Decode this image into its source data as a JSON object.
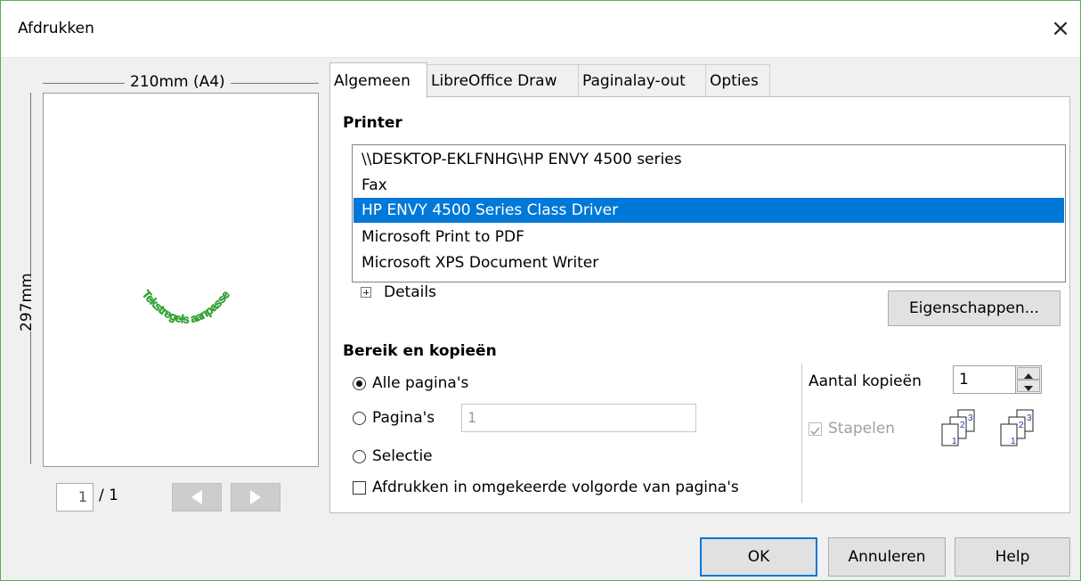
{
  "window": {
    "title": "Afdrukken",
    "close_glyph": "×"
  },
  "preview": {
    "width_label": "210mm (A4)",
    "height_label": "297mm",
    "current_page": "1",
    "total_pages": "/ 1",
    "art_text": "Tekstregels aanpassen",
    "art_color": "#2db52d"
  },
  "tabs": [
    {
      "label": "Algemeen",
      "active": true
    },
    {
      "label": "LibreOffice Draw",
      "active": false
    },
    {
      "label": "Paginalay-out",
      "active": false
    },
    {
      "label": "Opties",
      "active": false
    }
  ],
  "printer": {
    "heading": "Printer",
    "items": [
      "\\\\DESKTOP-EKLFNHG\\HP ENVY 4500 series",
      "Fax",
      "HP ENVY 4500 Series Class Driver",
      "Microsoft Print to PDF",
      "Microsoft XPS Document Writer"
    ],
    "selected_index": 2,
    "details_label": "Details",
    "properties_button": "Eigenschappen..."
  },
  "range": {
    "heading": "Bereik en kopieën",
    "all_pages": "Alle pagina's",
    "pages": "Pagina's",
    "pages_value": "1",
    "selection": "Selectie",
    "reverse_order": "Afdrukken in omgekeerde volgorde van pagina's",
    "copies_label": "Aantal kopieën",
    "copies_value": "1",
    "collate_label": "Stapelen",
    "collate_checked": true
  },
  "buttons": {
    "ok": "OK",
    "cancel": "Annuleren",
    "help": "Help"
  },
  "colors": {
    "selection": "#0078d7",
    "frame": "#5fa85f"
  }
}
